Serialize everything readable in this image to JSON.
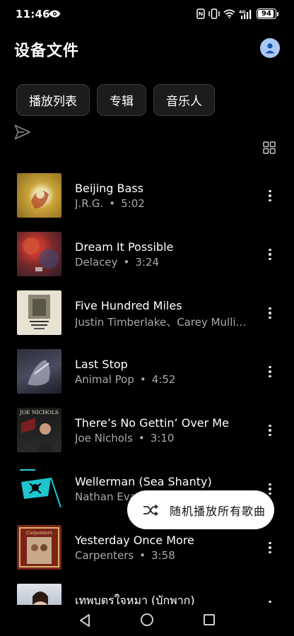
{
  "status": {
    "time": "11:46",
    "battery": "94",
    "battery_level": 0.94,
    "icons": [
      "eye-icon",
      "nfc-icon",
      "vibrate-icon",
      "wifi-icon",
      "signal-4g-icon",
      "battery-icon"
    ]
  },
  "header": {
    "title": "设备文件",
    "avatar_icon": "person-icon"
  },
  "tabs": [
    {
      "label": "播放列表"
    },
    {
      "label": "专辑"
    },
    {
      "label": "音乐人"
    }
  ],
  "songs": [
    {
      "title": "Beijing Bass",
      "artist": "J.R.G.",
      "duration": "5:02"
    },
    {
      "title": "Dream It Possible",
      "artist": "Delacey",
      "duration": "3:24"
    },
    {
      "title": "Five Hundred Miles",
      "artist": "Justin Timberlake、Carey Mulli…",
      "duration": ""
    },
    {
      "title": "Last Stop",
      "artist": "Animal Pop",
      "duration": "4:52"
    },
    {
      "title": "There’s No Gettin’ Over Me",
      "artist": "Joe Nichols",
      "duration": "3:10"
    },
    {
      "title": "Wellerman (Sea Shanty)",
      "artist": "Nathan Eva",
      "duration": ""
    },
    {
      "title": "Yesterday Once More",
      "artist": "Carpenters",
      "duration": "3:58"
    },
    {
      "title": "เทพบุตรใจหมา (บักพาก)",
      "artist": "",
      "duration": ""
    }
  ],
  "bullet": "•",
  "cover_texts": {
    "joe_nichols": "JOE NICHOLS",
    "carpenters": "Carpenters"
  },
  "shuffle": {
    "label": "随机播放所有歌曲",
    "icon": "shuffle-icon"
  },
  "colors": {
    "background": "#000000",
    "chip_bg": "#1c1c1c",
    "avatar": "#a9c8f5",
    "secondary_text": "#a9a9a9"
  }
}
